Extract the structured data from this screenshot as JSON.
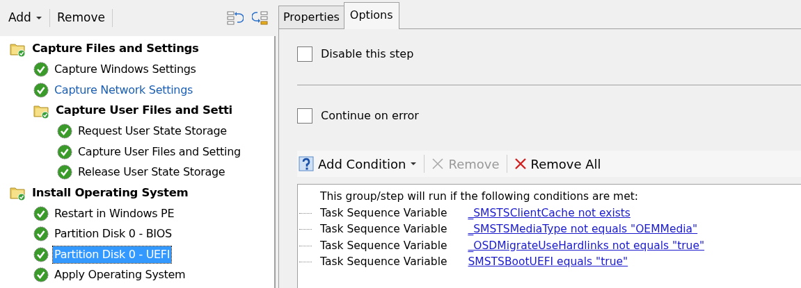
{
  "left_toolbar": {
    "add": "Add",
    "remove": "Remove"
  },
  "tree": [
    {
      "kind": "group",
      "label": "Capture Files and Settings",
      "selected": false,
      "hot": false,
      "children": [
        {
          "kind": "step",
          "label": "Capture Windows Settings",
          "selected": false,
          "hot": false
        },
        {
          "kind": "step",
          "label": "Capture Network Settings",
          "selected": false,
          "hot": true
        },
        {
          "kind": "group",
          "label": "Capture User Files and Setti",
          "selected": false,
          "hot": false,
          "children": [
            {
              "kind": "step",
              "label": "Request User State Storage",
              "selected": false,
              "hot": false
            },
            {
              "kind": "step",
              "label": "Capture User Files and Setting",
              "selected": false,
              "hot": false
            },
            {
              "kind": "step",
              "label": "Release User State Storage",
              "selected": false,
              "hot": false
            }
          ]
        }
      ]
    },
    {
      "kind": "group",
      "label": "Install Operating System",
      "selected": false,
      "hot": false,
      "children": [
        {
          "kind": "step",
          "label": "Restart in Windows PE",
          "selected": false,
          "hot": false
        },
        {
          "kind": "step",
          "label": "Partition Disk 0 - BIOS",
          "selected": false,
          "hot": false
        },
        {
          "kind": "step",
          "label": "Partition Disk 0 - UEFI",
          "selected": true,
          "hot": false
        },
        {
          "kind": "step",
          "label": "Apply Operating System",
          "selected": false,
          "hot": false
        }
      ]
    }
  ],
  "tabs": [
    {
      "label": "Properties",
      "selected": false
    },
    {
      "label": "Options",
      "selected": true
    }
  ],
  "options": [
    {
      "label": "Disable this step",
      "checked": false
    },
    {
      "label": "Continue on error",
      "checked": false
    }
  ],
  "condition_toolbar": {
    "add": "Add Condition",
    "remove": "Remove",
    "remove_all": "Remove All",
    "remove_disabled": true
  },
  "conditions": {
    "intro": "This group/step will run if the following conditions are met:",
    "items": [
      {
        "type": "Task Sequence Variable",
        "condition": "_SMSTSClientCache not exists"
      },
      {
        "type": "Task Sequence Variable",
        "condition": "_SMSTSMediaType not equals \"OEMMedia\""
      },
      {
        "type": "Task Sequence Variable",
        "condition": "_OSDMigrateUseHardlinks not equals \"true\""
      },
      {
        "type": "Task Sequence Variable",
        "condition": "SMSTSBootUEFI equals \"true\""
      }
    ]
  }
}
